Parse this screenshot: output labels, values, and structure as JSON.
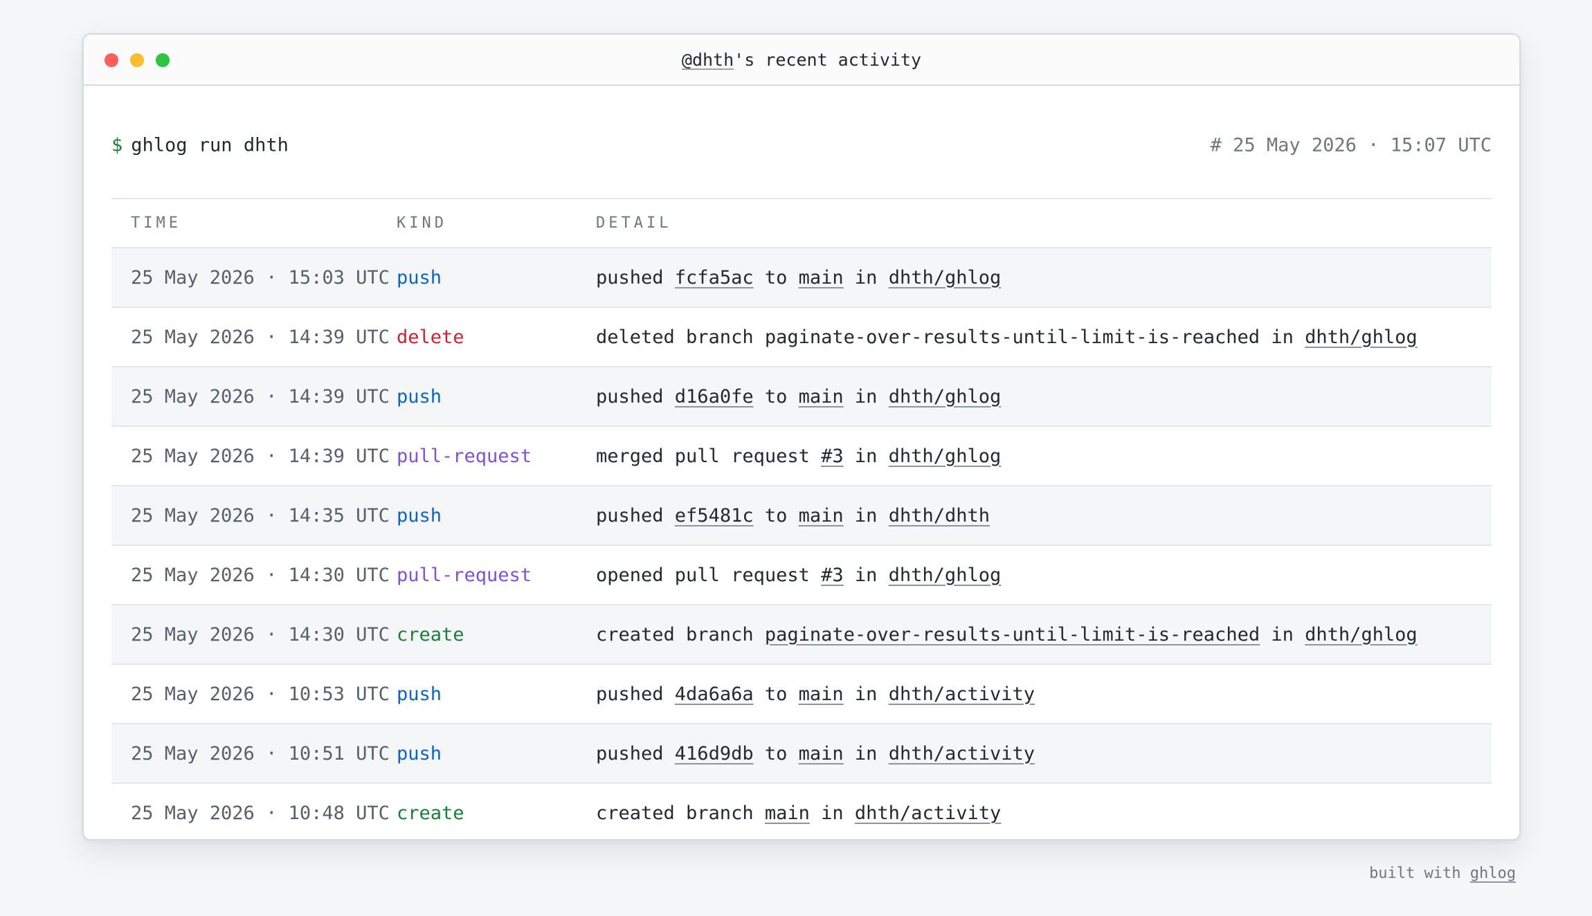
{
  "window": {
    "title_handle": "@dhth",
    "title_rest": "'s recent activity"
  },
  "command": {
    "prompt": "$",
    "text": "ghlog run dhth",
    "timestamp": "# 25 May 2026 · 15:07 UTC"
  },
  "table": {
    "headers": {
      "time": "TIME",
      "kind": "KIND",
      "detail": "DETAIL"
    },
    "rows": [
      {
        "time": "25 May 2026 · 15:03 UTC",
        "kind": "push",
        "detail": [
          {
            "t": "pushed "
          },
          {
            "t": "fcfa5ac",
            "link": true
          },
          {
            "t": " to "
          },
          {
            "t": "main",
            "link": true
          },
          {
            "t": " in "
          },
          {
            "t": "dhth/ghlog",
            "link": true
          }
        ]
      },
      {
        "time": "25 May 2026 · 14:39 UTC",
        "kind": "delete",
        "detail": [
          {
            "t": "deleted branch paginate-over-results-until-limit-is-reached in "
          },
          {
            "t": "dhth/ghlog",
            "link": true
          }
        ]
      },
      {
        "time": "25 May 2026 · 14:39 UTC",
        "kind": "push",
        "detail": [
          {
            "t": "pushed "
          },
          {
            "t": "d16a0fe",
            "link": true
          },
          {
            "t": " to "
          },
          {
            "t": "main",
            "link": true
          },
          {
            "t": " in "
          },
          {
            "t": "dhth/ghlog",
            "link": true
          }
        ]
      },
      {
        "time": "25 May 2026 · 14:39 UTC",
        "kind": "pull-request",
        "detail": [
          {
            "t": "merged pull request "
          },
          {
            "t": "#3",
            "link": true
          },
          {
            "t": " in "
          },
          {
            "t": "dhth/ghlog",
            "link": true
          }
        ]
      },
      {
        "time": "25 May 2026 · 14:35 UTC",
        "kind": "push",
        "detail": [
          {
            "t": "pushed "
          },
          {
            "t": "ef5481c",
            "link": true
          },
          {
            "t": " to "
          },
          {
            "t": "main",
            "link": true
          },
          {
            "t": " in "
          },
          {
            "t": "dhth/dhth",
            "link": true
          }
        ]
      },
      {
        "time": "25 May 2026 · 14:30 UTC",
        "kind": "pull-request",
        "detail": [
          {
            "t": "opened pull request "
          },
          {
            "t": "#3",
            "link": true
          },
          {
            "t": " in "
          },
          {
            "t": "dhth/ghlog",
            "link": true
          }
        ]
      },
      {
        "time": "25 May 2026 · 14:30 UTC",
        "kind": "create",
        "detail": [
          {
            "t": "created branch "
          },
          {
            "t": "paginate-over-results-until-limit-is-reached",
            "link": true
          },
          {
            "t": " in "
          },
          {
            "t": "dhth/ghlog",
            "link": true
          }
        ]
      },
      {
        "time": "25 May 2026 · 10:53 UTC",
        "kind": "push",
        "detail": [
          {
            "t": "pushed "
          },
          {
            "t": "4da6a6a",
            "link": true
          },
          {
            "t": " to "
          },
          {
            "t": "main",
            "link": true
          },
          {
            "t": " in "
          },
          {
            "t": "dhth/activity",
            "link": true
          }
        ]
      },
      {
        "time": "25 May 2026 · 10:51 UTC",
        "kind": "push",
        "detail": [
          {
            "t": "pushed "
          },
          {
            "t": "416d9db",
            "link": true
          },
          {
            "t": " to "
          },
          {
            "t": "main",
            "link": true
          },
          {
            "t": " in "
          },
          {
            "t": "dhth/activity",
            "link": true
          }
        ]
      },
      {
        "time": "25 May 2026 · 10:48 UTC",
        "kind": "create",
        "detail": [
          {
            "t": "created branch "
          },
          {
            "t": "main",
            "link": true
          },
          {
            "t": " in "
          },
          {
            "t": "dhth/activity",
            "link": true
          }
        ]
      }
    ]
  },
  "footer": {
    "text": "built with ",
    "link": "ghlog"
  },
  "colors": {
    "push": "#0b63ce",
    "delete": "#cf222e",
    "pull-request": "#8250df",
    "create": "#1a7f37"
  }
}
